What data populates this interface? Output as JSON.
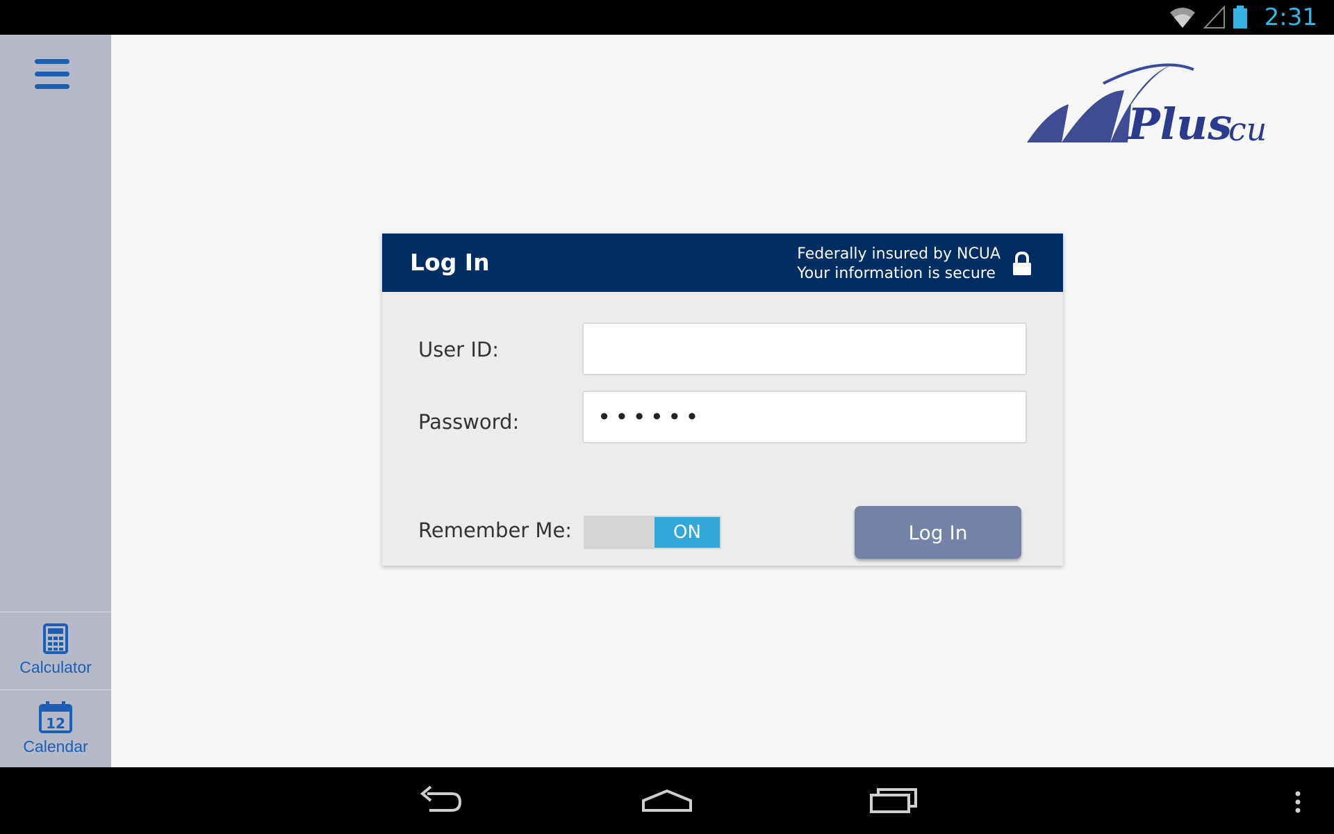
{
  "status_bar": {
    "time": "2:31",
    "icons": [
      "wifi-icon",
      "cell-signal-icon",
      "battery-icon"
    ]
  },
  "sidebar": {
    "menu_icon": "hamburger-menu-icon",
    "items": [
      {
        "label": "Calculator",
        "icon": "calculator-icon"
      },
      {
        "label": "Calendar",
        "icon": "calendar-icon",
        "icon_text": "12"
      }
    ]
  },
  "brand": {
    "logo_text": "NWPlus cu"
  },
  "login": {
    "title": "Log In",
    "secure_line1": "Federally insured by NCUA",
    "secure_line2": "Your information is secure",
    "user_id_label": "User ID:",
    "user_id_value": "",
    "password_label": "Password:",
    "password_value": "••••••",
    "remember_label": "Remember Me:",
    "remember_state": "ON",
    "submit_label": "Log In"
  },
  "navigation": {
    "buttons": [
      "back-icon",
      "home-icon",
      "recent-apps-icon",
      "overflow-menu-icon"
    ]
  },
  "colors": {
    "header_bg": "#002d62",
    "accent": "#1a5fb4",
    "toggle_on": "#32a8d8",
    "button": "#7482a8",
    "status_text": "#35b5e5"
  }
}
